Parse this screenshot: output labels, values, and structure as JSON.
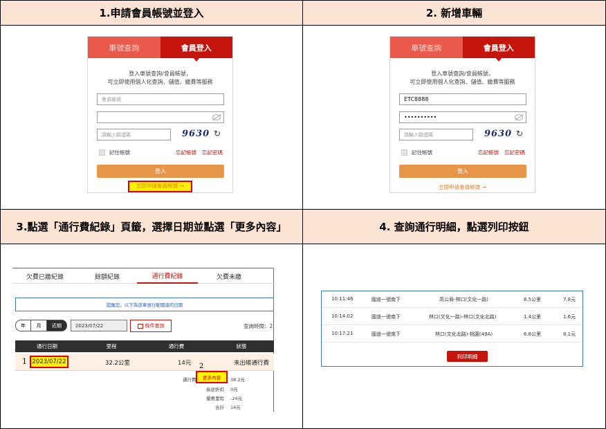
{
  "steps": [
    {
      "title": "1.申請會員帳號並登入"
    },
    {
      "title": "2. 新增車輛"
    },
    {
      "title": "3.點選「通行費紀錄」頁籤，選擇日期並點選「更多內容」"
    },
    {
      "title": "4. 查詢通行明細，點選列印按鈕"
    }
  ],
  "login_card_1": {
    "tab_plate": "車號查詢",
    "tab_member": "會員登入",
    "info_line1": "登入車號查詢/會員帳號，",
    "info_line2": "可立即使用個人化查詢、儲值、繳費等服務",
    "account_placeholder": "會員帳號",
    "password_value": "",
    "captcha_placeholder": "請輸入驗證碼",
    "captcha": "9630",
    "refresh_glyph": "↻",
    "remember": "記住帳號",
    "forgot_account": "忘記帳號",
    "forgot_password": "忘記密碼",
    "login_button": "登入",
    "register_link": "立即申請會員帳號 →"
  },
  "login_card_2": {
    "tab_plate": "車號查詢",
    "tab_member": "會員登入",
    "info_line1": "登入車號查詢/會員帳號，",
    "info_line2": "可立即使用個人化查詢、儲值、繳費等服務",
    "account_value": "ETC8888",
    "password_value": "••••••••••",
    "captcha_placeholder": "請輸入驗證碼",
    "captcha": "9630",
    "refresh_glyph": "↻",
    "remember": "記住帳號",
    "forgot_account": "忘記帳號",
    "forgot_password": "忘記密碼",
    "login_button": "登入",
    "register_link": "立即申請會員帳號 →"
  },
  "toll_panel": {
    "tabs": [
      "欠費已繳紀錄",
      "餘額紀錄",
      "通行費紀錄",
      "欠費未繳"
    ],
    "notice": "提醒您，以下為該車號行駛國道的日期",
    "segments": [
      "年",
      "月",
      "近期"
    ],
    "date_value": "2023/07/22",
    "date_query_button": "條件查詢",
    "query_time_label": "查詢時間：2",
    "headers": [
      "通行日期",
      "里程",
      "通行費",
      "狀態"
    ],
    "row": {
      "index": "1",
      "date": "2023/07/22",
      "distance": "32.2公里",
      "fee": "14元",
      "status": "未出帳通行費"
    },
    "step_marker": "2",
    "more_label": "通行費",
    "more_button": "更多內容",
    "more_value": "38.2元",
    "details": [
      {
        "label": "長途折扣",
        "value": "0元"
      },
      {
        "label": "優惠里程",
        "value": "-24元"
      },
      {
        "label": "合計",
        "value": "14元"
      }
    ]
  },
  "detail_panel": {
    "rows": [
      {
        "time": "10:11:46",
        "road": "國道一號南下",
        "section": "高公局-林口(文化一路)",
        "distance": "6.5公里",
        "fee": "7.8元"
      },
      {
        "time": "10:14:02",
        "road": "國道一號南下",
        "section": "林口(文化一路)-林口(文化北路)",
        "distance": "1.4公里",
        "fee": "1.6元"
      },
      {
        "time": "10:17:21",
        "road": "國道一號南下",
        "section": "林口(文化北路)-桃園(49A)",
        "distance": "6.8公里",
        "fee": "8.1元"
      }
    ],
    "print_button": "列印明細"
  }
}
